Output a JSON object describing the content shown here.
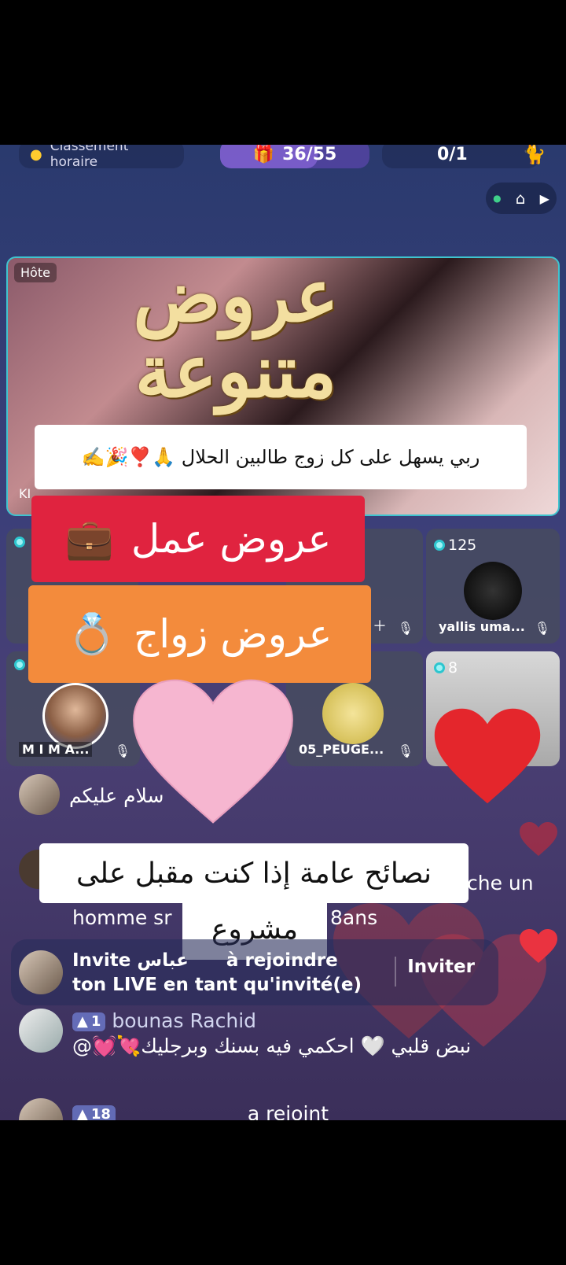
{
  "topbar": {
    "ranking_label": "Classement horaire",
    "progress": "36/55",
    "progress_fraction": 0.65,
    "count": "0/1"
  },
  "host": {
    "label": "Hôte",
    "title_line1": "عروض",
    "title_line2": "متنوعة",
    "name_fragment": "KI"
  },
  "captions": {
    "prayer": "ربي يسهل على كل زوج طالبين الحلال 🙏❣️🎉✍️",
    "job_offers": "عروض عمل",
    "job_emoji": "💼",
    "marriage_offers": "عروض زواج",
    "marriage_emoji": "💍",
    "advice_line1": "نصائح عامة إذا كنت مقبل على",
    "advice_line2": "مشروع"
  },
  "guests": [
    {
      "score": "125",
      "name": "yallis uma..."
    },
    {
      "name": "M I M A..."
    },
    {
      "name": "05_PEUGE..."
    },
    {
      "score": "8"
    }
  ],
  "chat": {
    "greeting": "سلام عليكم",
    "partial_line1": "che un",
    "partial_line2_a": "homme sr",
    "partial_line2_b": "8ans",
    "invite_text_a": "Invite",
    "invite_name": "عباس",
    "invite_text_b": "à rejoindre",
    "invite_text_c": "ton LIVE en tant qu'invité(e)",
    "invite_button": "Inviter",
    "msg_level": "1",
    "msg_user": "bounas Rachid",
    "msg_text": "نبض قلبي 🤍 احكمي فيه بسنك وبرجليك💘💓@",
    "last_level": "18",
    "last_text": "a rejoint"
  },
  "colors": {
    "host_border": "#3fc4cf",
    "job_box": "#e0233f",
    "marriage_box": "#f38b3c",
    "pink_heart": "#f6b6d0",
    "red_heart": "#e4262c"
  },
  "icons": [
    "trophy-icon",
    "home-icon",
    "play-icon",
    "diamond-icon",
    "mic-off-icon",
    "plus-icon",
    "level-arrow-icon",
    "heart-icon"
  ]
}
